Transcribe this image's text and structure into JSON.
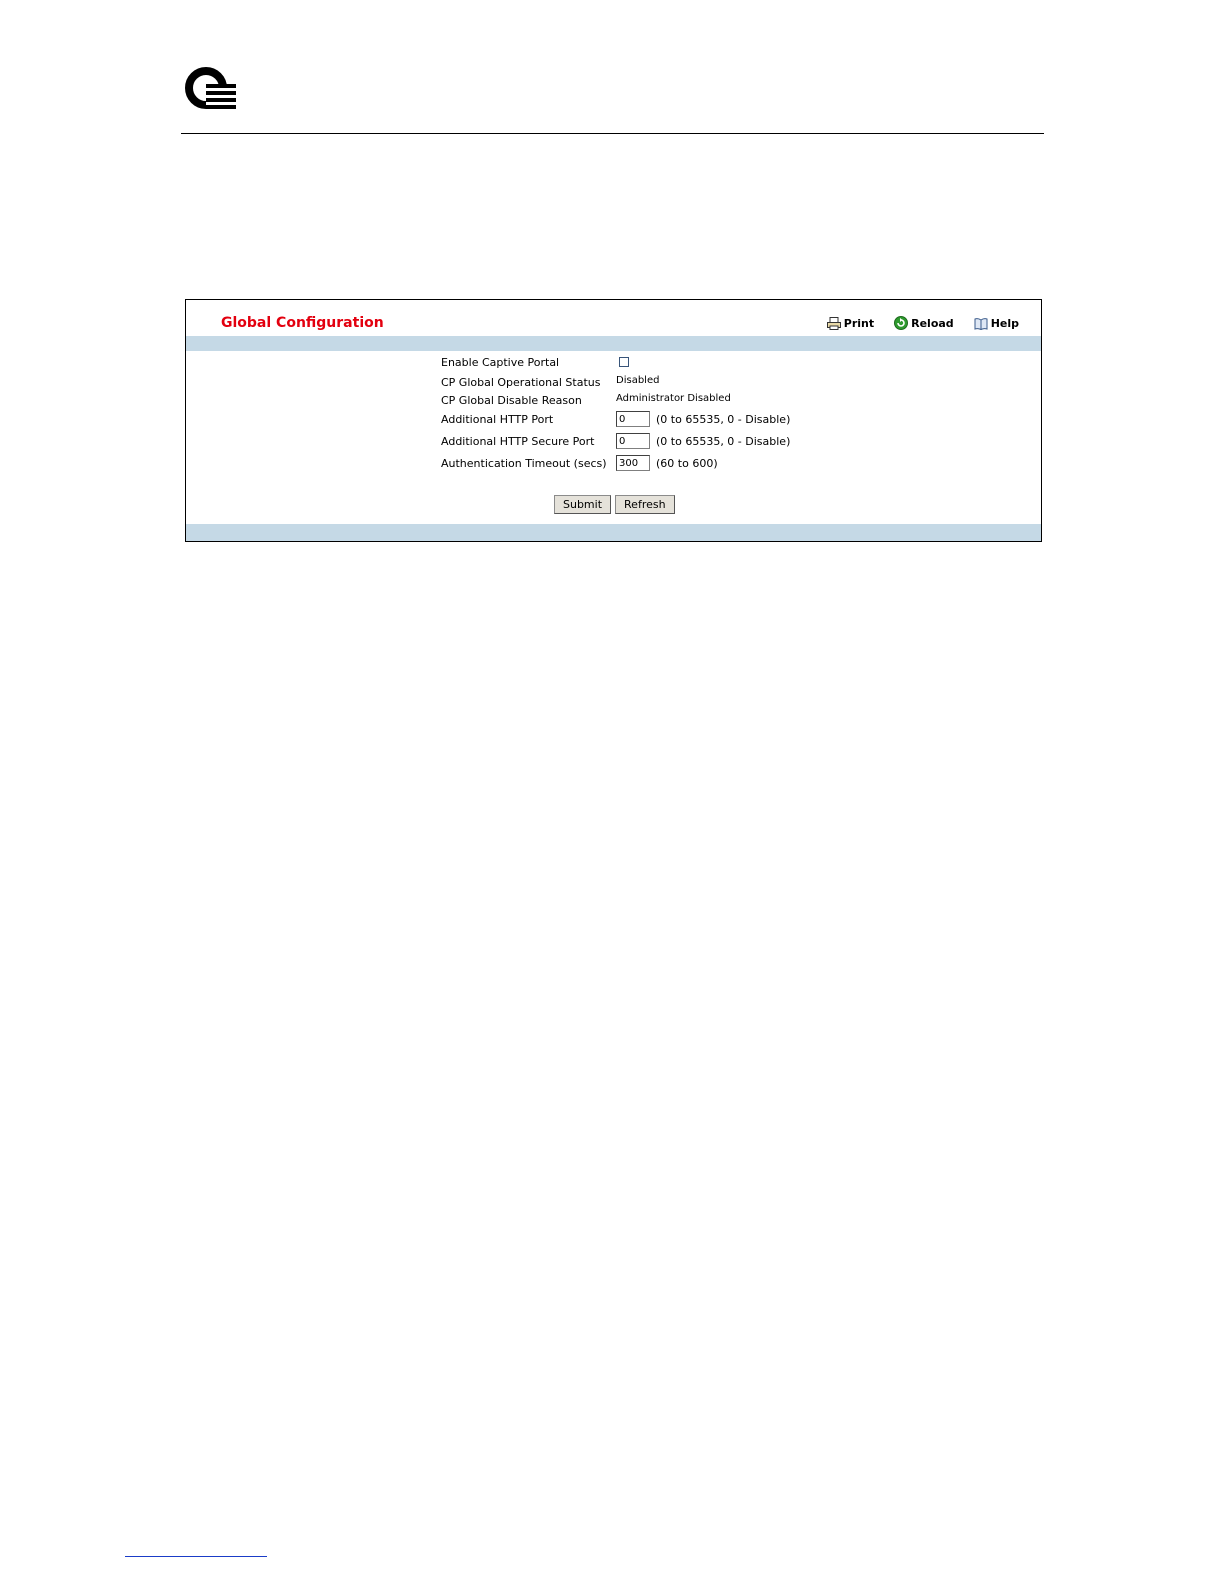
{
  "page": {
    "title": "Global Configuration"
  },
  "toolbar": {
    "print_label": "Print",
    "reload_label": "Reload",
    "help_label": "Help",
    "print_icon": "printer-icon",
    "reload_icon": "reload-icon",
    "help_icon": "help-book-icon"
  },
  "form": {
    "enable_captive_portal": {
      "label": "Enable Captive Portal",
      "checked": false
    },
    "operational_status": {
      "label": "CP Global Operational Status",
      "value": "Disabled"
    },
    "disable_reason": {
      "label": "CP Global Disable Reason",
      "value": "Administrator Disabled"
    },
    "http_port": {
      "label": "Additional HTTP Port",
      "value": "0",
      "hint": "(0 to 65535, 0 - Disable)"
    },
    "https_port": {
      "label": "Additional HTTP Secure Port",
      "value": "0",
      "hint": "(0 to 65535, 0 - Disable)"
    },
    "auth_timeout": {
      "label": "Authentication Timeout (secs)",
      "value": "300",
      "hint": "(60 to 600)"
    }
  },
  "buttons": {
    "submit_label": "Submit",
    "refresh_label": "Refresh"
  },
  "colors": {
    "title": "#e3000f",
    "band": "#c5d9e6"
  }
}
